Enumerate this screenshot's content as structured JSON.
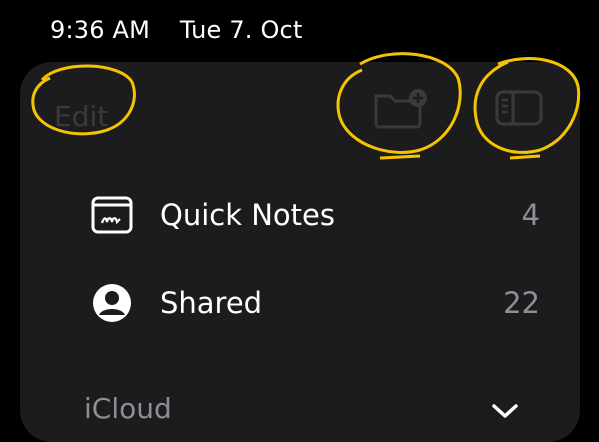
{
  "status": {
    "time": "9:36 AM",
    "date": "Tue 7. Oct"
  },
  "toolbar": {
    "edit_label": "Edit",
    "new_folder_icon": "folder-plus-icon",
    "sidebar_icon": "sidebar-icon"
  },
  "folders": [
    {
      "label": "Quick Notes",
      "count": "4",
      "icon": "quick-note-icon"
    },
    {
      "label": "Shared",
      "count": "22",
      "icon": "person-circle-icon"
    }
  ],
  "sections": {
    "icloud_title": "iCloud"
  },
  "colors": {
    "background": "#000000",
    "panel": "#1c1c1e",
    "highlight": "#f5c400",
    "muted": "#8e8e93"
  }
}
